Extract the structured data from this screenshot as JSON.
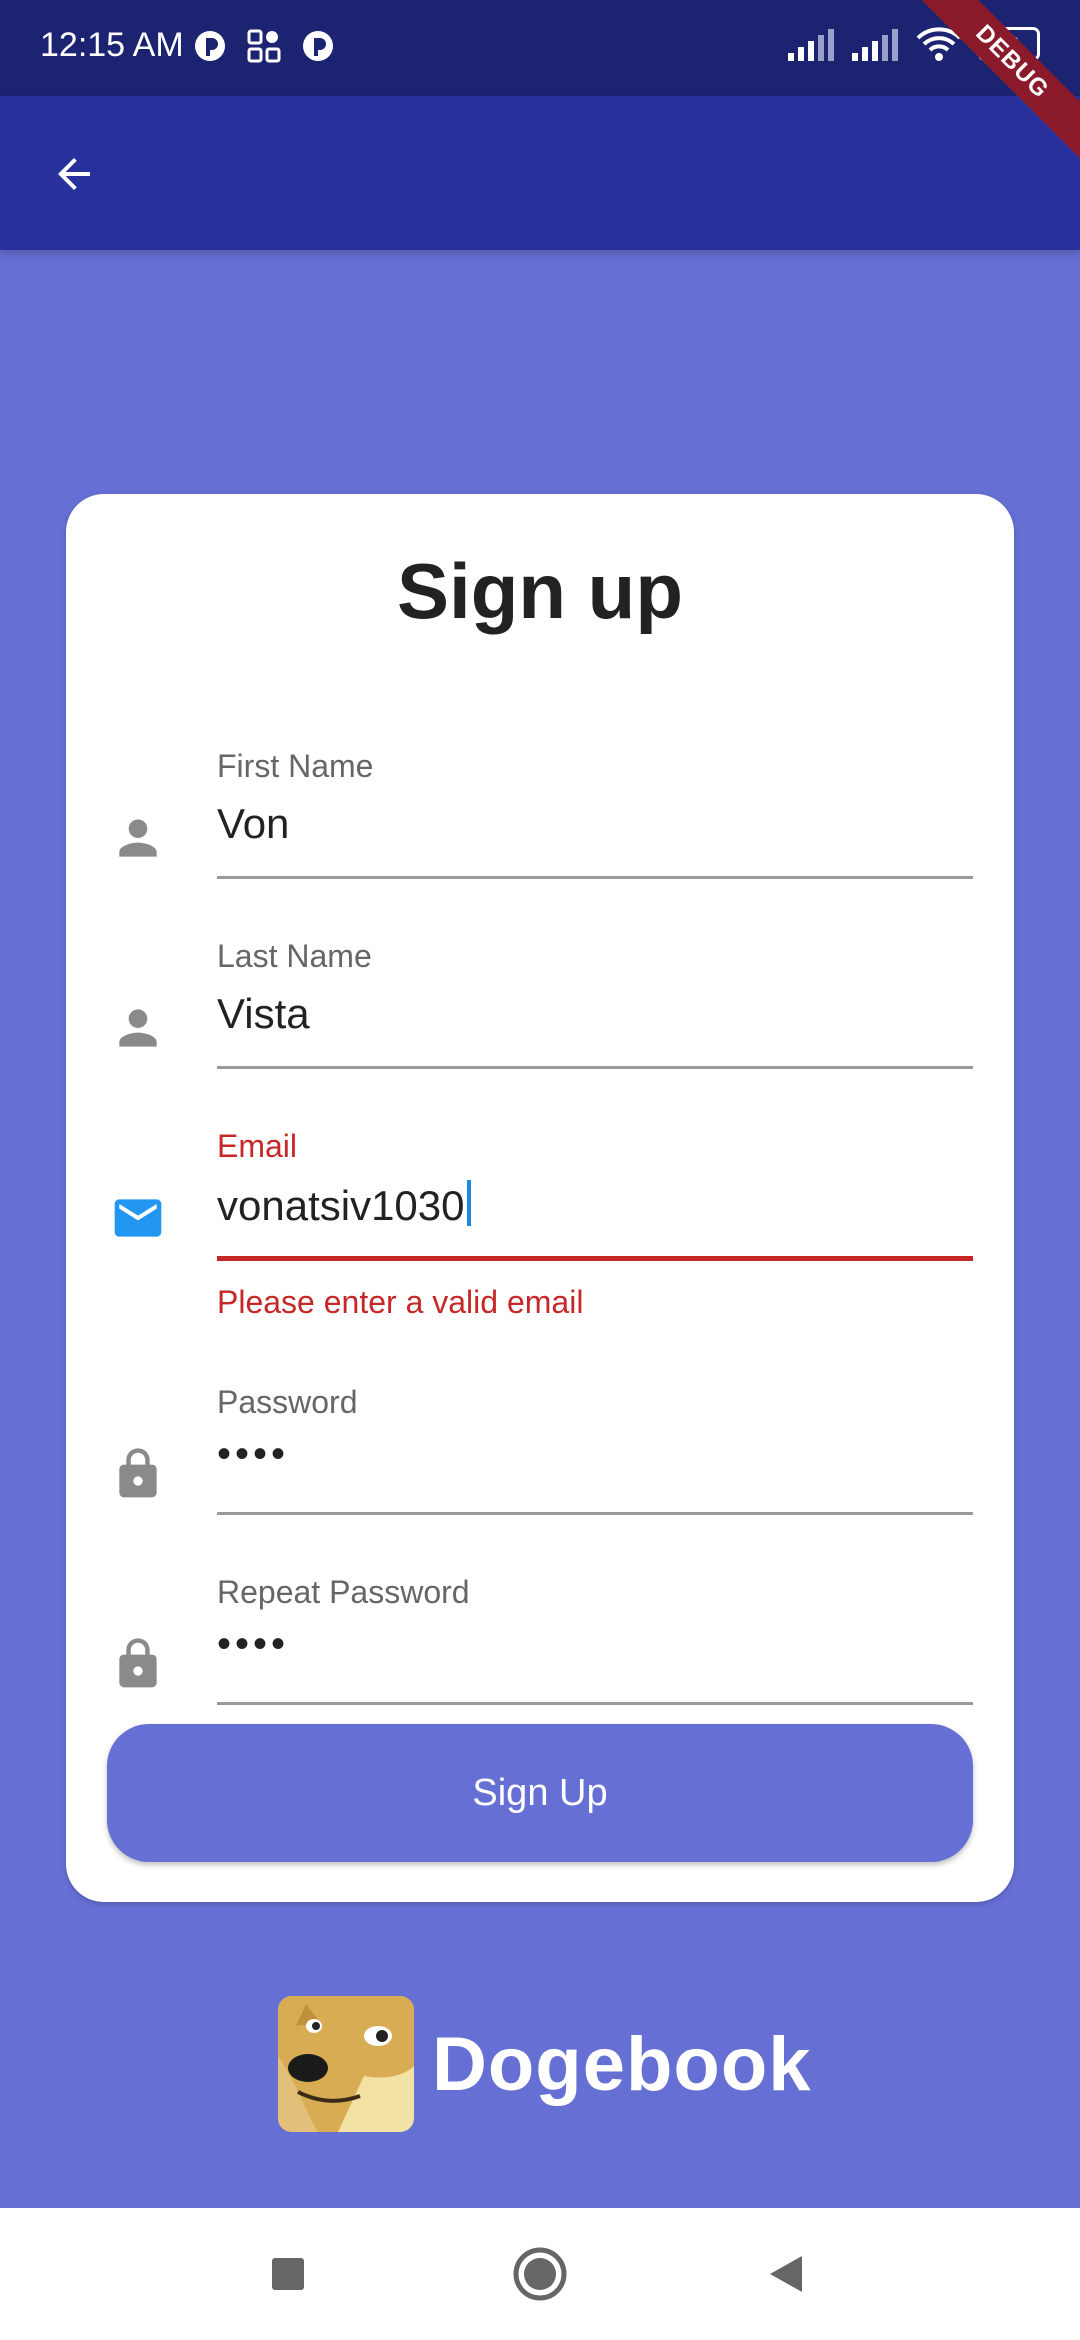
{
  "status_bar": {
    "time": "12:15 AM",
    "battery": "36"
  },
  "debug_banner": "DEBUG",
  "card": {
    "title": "Sign up",
    "fields": [
      {
        "label": "First Name",
        "value": "Von",
        "icon": "person-icon"
      },
      {
        "label": "Last Name",
        "value": "Vista",
        "icon": "person-icon"
      },
      {
        "label": "Email",
        "value": "vonatsiv1030",
        "icon": "email-icon",
        "error": "Please enter a valid email"
      },
      {
        "label": "Password",
        "value": "••••",
        "icon": "lock-icon"
      },
      {
        "label": "Repeat Password",
        "value": "••••",
        "icon": "lock-icon"
      }
    ],
    "submit_label": "Sign Up"
  },
  "brand": {
    "name": "Dogebook"
  },
  "colors": {
    "primary": "#6670d4",
    "app_bar": "#27309d",
    "status_bar": "#1c2472",
    "error": "#c62828",
    "email_icon": "#2196f3"
  }
}
